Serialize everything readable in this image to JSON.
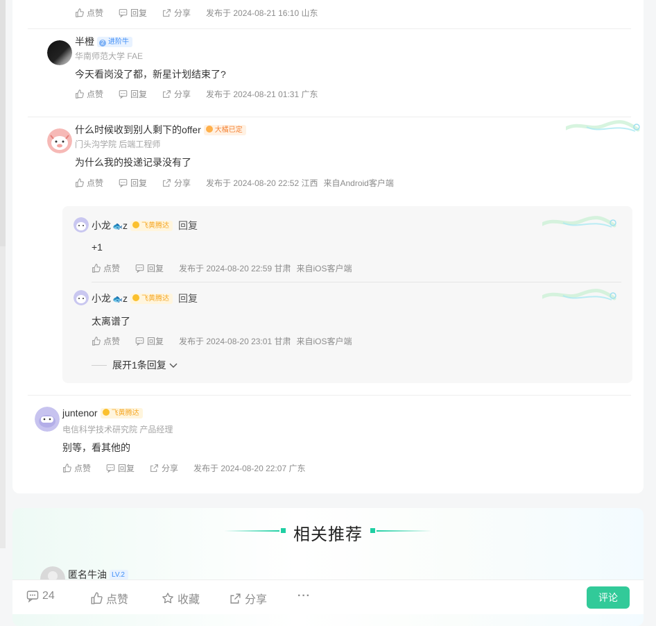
{
  "comments": [
    {
      "actions": {
        "like": "点赞",
        "reply": "回复",
        "share": "分享",
        "meta": "发布于 2024-08-21 16:10 山东",
        "client": ""
      }
    },
    {
      "user": "半橙",
      "badge": "进阶牛",
      "badge_num": "2",
      "subtitle": "华南师范大学 FAE",
      "content": "今天看岗没了都，新星计划结束了?",
      "actions": {
        "like": "点赞",
        "reply": "回复",
        "share": "分享",
        "meta": "发布于 2024-08-21 01:31 广东",
        "client": ""
      }
    },
    {
      "user": "什么时候收到别人剩下的offer",
      "badge": "大橘已定",
      "subtitle": "门头沟学院 后端工程师",
      "content": "为什么我的投递记录没有了",
      "actions": {
        "like": "点赞",
        "reply": "回复",
        "share": "分享",
        "meta": "发布于 2024-08-20 22:52 江西",
        "client": "来自Android客户端"
      },
      "replies": [
        {
          "user": "小龙",
          "user_suffix": "z",
          "badge": "飞黄腾达",
          "reply_word": "回复",
          "content": "+1",
          "actions": {
            "like": "点赞",
            "reply": "回复",
            "meta": "发布于 2024-08-20 22:59 甘肃",
            "client": "来自iOS客户端"
          }
        },
        {
          "user": "小龙",
          "user_suffix": "z",
          "badge": "飞黄腾达",
          "reply_word": "回复",
          "content": "太离谱了",
          "actions": {
            "like": "点赞",
            "reply": "回复",
            "meta": "发布于 2024-08-20 23:01 甘肃",
            "client": "来自iOS客户端"
          }
        }
      ],
      "expand": "展开1条回复"
    },
    {
      "user": "juntenor",
      "badge": "飞黄腾达",
      "subtitle": "电信科学技术研究院 产品经理",
      "content": "别等，看其他的",
      "actions": {
        "like": "点赞",
        "reply": "回复",
        "share": "分享",
        "meta": "发布于 2024-08-20 22:07 广东",
        "client": ""
      }
    }
  ],
  "recommend": {
    "title": "相关推荐",
    "first_user": "匿名牛油",
    "first_badge": "LV.2"
  },
  "bottom_bar": {
    "comment_count": "24",
    "like": "点赞",
    "collect": "收藏",
    "share": "分享",
    "more": "···",
    "comment_button": "评论"
  },
  "colors": {
    "accent": "#32ca99",
    "badge_blue": "#3e8df7",
    "badge_orange": "#f5863a",
    "badge_gold": "#f5a623"
  }
}
